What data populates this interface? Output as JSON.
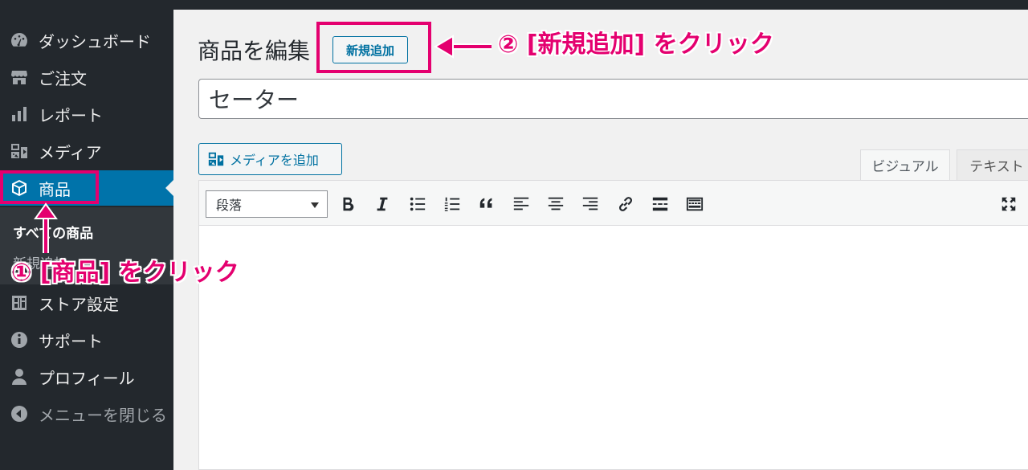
{
  "sidebar": {
    "items": [
      {
        "label": "ダッシュボード",
        "icon": "dashboard-icon"
      },
      {
        "label": "ご注文",
        "icon": "store-icon"
      },
      {
        "label": "レポート",
        "icon": "chart-bars-icon"
      },
      {
        "label": "メディア",
        "icon": "media-icon"
      },
      {
        "label": "商品",
        "icon": "box-icon"
      },
      {
        "label": "ストア設定",
        "icon": "settings-icon"
      },
      {
        "label": "サポート",
        "icon": "info-icon"
      },
      {
        "label": "プロフィール",
        "icon": "user-icon"
      },
      {
        "label": "メニューを閉じる",
        "icon": "collapse-icon"
      }
    ],
    "submenu": [
      {
        "label": "すべての商品"
      },
      {
        "label": "新規追加"
      }
    ]
  },
  "main": {
    "page_title": "商品を編集",
    "add_new_label": "新規追加",
    "title_value": "セーター",
    "media_button_label": "メディアを追加",
    "tabs": [
      {
        "label": "ビジュアル"
      },
      {
        "label": "テキスト"
      }
    ],
    "toolbar": {
      "format_value": "段落"
    }
  },
  "annotations": {
    "step1": "① [商品] をクリック",
    "step2": "② [新規追加] をクリック",
    "color": "#e4006f"
  },
  "colors": {
    "sidebar_bg": "#23282d",
    "active_bg": "#0073aa",
    "accent": "#0071a1"
  }
}
